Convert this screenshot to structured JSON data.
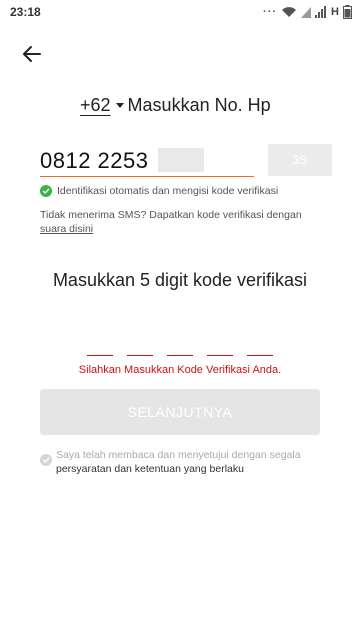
{
  "status_bar": {
    "time": "23:18",
    "network": "H"
  },
  "phone_section": {
    "country_code": "+62",
    "title": "Masukkan No. Hp",
    "phone_value": "0812 2253",
    "resend_label": "3S"
  },
  "auto_verify_text": "Identifikasi otomatis dan mengisi kode verifikasi",
  "sms": {
    "prefix": "Tidak menerima SMS? Dapatkan kode verifikasi dengan",
    "link": "suara disini"
  },
  "verification": {
    "title": "Masukkan 5 digit kode verifikasi",
    "error": "Silahkan Masukkan Kode Verifikasi Anda."
  },
  "next_label": "SELANJUTNYA",
  "agreement": {
    "prefix": "Saya telah membaca dan menyetujui dengan segala",
    "link": "persyaratan dan ketentuan yang berlaku"
  },
  "colors": {
    "accent": "#e3702b",
    "error": "#d01111",
    "success": "#38b24a"
  },
  "icons": [
    "back-arrow-icon",
    "wifi-icon",
    "signal-icon",
    "battery-icon",
    "check-circle-icon"
  ]
}
